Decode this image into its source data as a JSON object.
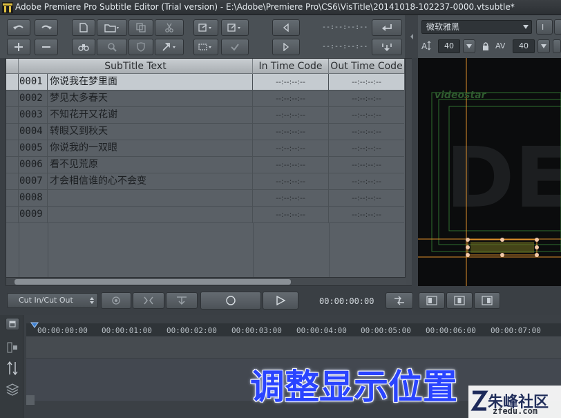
{
  "window": {
    "title": "Adobe Premiere Pro Subtitle Editor (Trial version) - E:\\Adobe\\Premiere Pro\\CS6\\VisTitle\\20141018-102237-0000.vtsubtle*"
  },
  "toolbar": {
    "timecode_a": "--:--:--:--",
    "timecode_b": "--:--:--:--"
  },
  "preview_controls": {
    "font": "微软雅黑",
    "size_a": "40",
    "size_b": "40"
  },
  "table": {
    "columns": [
      "SubTitle Text",
      "In Time Code",
      "Out Time Code"
    ],
    "rows": [
      {
        "index": "0001",
        "text": "你说我在梦里面",
        "in": "--:--:--:--",
        "out": "--:--:--:--"
      },
      {
        "index": "0002",
        "text": "梦见太多春天",
        "in": "--:--:--:--",
        "out": "--:--:--:--"
      },
      {
        "index": "0003",
        "text": "不知花开又花谢",
        "in": "--:--:--:--",
        "out": "--:--:--:--"
      },
      {
        "index": "0004",
        "text": "转眼又到秋天",
        "in": "--:--:--:--",
        "out": "--:--:--:--"
      },
      {
        "index": "0005",
        "text": "你说我的一双眼",
        "in": "--:--:--:--",
        "out": "--:--:--:--"
      },
      {
        "index": "0006",
        "text": "看不见荒原",
        "in": "--:--:--:--",
        "out": "--:--:--:--"
      },
      {
        "index": "0007",
        "text": "才会相信谁的心不会变",
        "in": "--:--:--:--",
        "out": "--:--:--:--"
      },
      {
        "index": "0008",
        "text": "",
        "in": "--:--:--:--",
        "out": "--:--:--:--"
      },
      {
        "index": "0009",
        "text": "",
        "in": "--:--:--:--",
        "out": "--:--:--:--"
      }
    ]
  },
  "preview": {
    "logo": "videostar"
  },
  "bottom": {
    "mode_select": "Cut In/Cut Out",
    "timecode": "00:00:00:00"
  },
  "timeline": {
    "ticks": [
      "00:00:00:00",
      "00:00:01:00",
      "00:00:02:00",
      "00:00:03:00",
      "00:00:04:00",
      "00:00:05:00",
      "00:00:06:00",
      "00:00:07:00"
    ]
  },
  "overlay": {
    "caption": "调整显示位置",
    "watermark": "朱峰社区",
    "watermark_url": "zfedu.com"
  },
  "colors": {
    "accent_orange": "#e0902a",
    "guide_green": "#3f8f3f",
    "caption_blue": "#2a44ff",
    "selected_row": "#c5cbd0"
  }
}
